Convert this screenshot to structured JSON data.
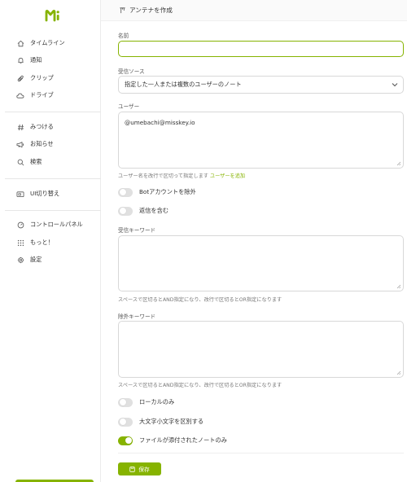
{
  "sidebar": {
    "items": [
      {
        "label": "タイムライン",
        "icon": "home-icon"
      },
      {
        "label": "通知",
        "icon": "bell-icon"
      },
      {
        "label": "クリップ",
        "icon": "paperclip-icon"
      },
      {
        "label": "ドライブ",
        "icon": "cloud-icon"
      },
      {
        "label": "みつける",
        "icon": "hashtag-icon"
      },
      {
        "label": "お知らせ",
        "icon": "megaphone-icon"
      },
      {
        "label": "検索",
        "icon": "search-icon"
      },
      {
        "label": "UI切り替え",
        "icon": "switch-ui-icon"
      },
      {
        "label": "コントロールパネル",
        "icon": "gauge-icon"
      },
      {
        "label": "もっと！",
        "icon": "dots-grid-icon"
      },
      {
        "label": "設定",
        "icon": "gear-icon"
      }
    ]
  },
  "header": {
    "title": "アンテナを作成",
    "icon": "antenna-icon"
  },
  "form": {
    "name_label": "名前",
    "name_value": "",
    "source_label": "受信ソース",
    "source_value": "指定した一人または複数のユーザーのノート",
    "users_label": "ユーザー",
    "users_value": "@umebachi@misskey.io",
    "users_hint": "ユーザー名を改行で区切って指定します",
    "users_hint_link": "ユーザーを追加",
    "toggle_bot": {
      "label": "Botアカウントを除外",
      "on": false
    },
    "toggle_replies": {
      "label": "返信を含む",
      "on": false
    },
    "keywords_label": "受信キーワード",
    "keywords_value": "",
    "keywords_hint": "スペースで区切るとAND指定になり、改行で区切るとOR指定になります",
    "exclude_label": "除外キーワード",
    "exclude_value": "",
    "exclude_hint": "スペースで区切るとAND指定になり、改行で区切るとOR指定になります",
    "toggle_local": {
      "label": "ローカルのみ",
      "on": false
    },
    "toggle_case": {
      "label": "大文字小文字を区別する",
      "on": false
    },
    "toggle_files": {
      "label": "ファイルが添付されたノートのみ",
      "on": true
    },
    "save_label": "保存"
  },
  "colors": {
    "accent": "#86b300"
  }
}
